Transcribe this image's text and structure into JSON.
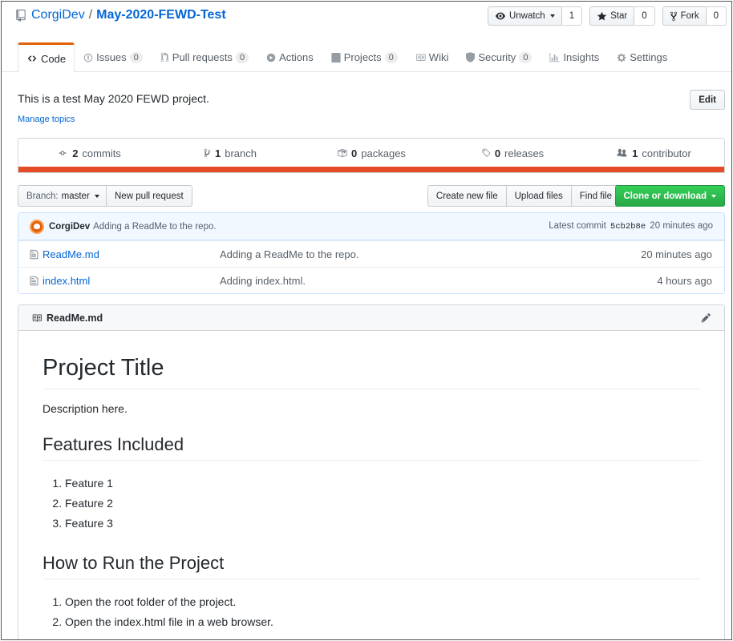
{
  "repo": {
    "owner": "CorgiDev",
    "separator": "/",
    "name": "May-2020-FEWD-Test"
  },
  "actions": {
    "watch": {
      "label": "Unwatch",
      "count": "1"
    },
    "star": {
      "label": "Star",
      "count": "0"
    },
    "fork": {
      "label": "Fork",
      "count": "0"
    }
  },
  "tabs": [
    {
      "label": "Code",
      "icon": "code-icon",
      "counter": ""
    },
    {
      "label": "Issues",
      "icon": "issue-icon",
      "counter": "0"
    },
    {
      "label": "Pull requests",
      "icon": "pull-request-icon",
      "counter": "0"
    },
    {
      "label": "Actions",
      "icon": "play-icon",
      "counter": ""
    },
    {
      "label": "Projects",
      "icon": "project-icon",
      "counter": "0"
    },
    {
      "label": "Wiki",
      "icon": "book-icon",
      "counter": ""
    },
    {
      "label": "Security",
      "icon": "shield-icon",
      "counter": "0"
    },
    {
      "label": "Insights",
      "icon": "graph-icon",
      "counter": ""
    },
    {
      "label": "Settings",
      "icon": "gear-icon",
      "counter": ""
    }
  ],
  "description": "This is a test May 2020 FEWD project.",
  "manage_topics": "Manage topics",
  "edit_label": "Edit",
  "summary": {
    "commits": {
      "num": "2",
      "label": "commits"
    },
    "branch": {
      "num": "1",
      "label": "branch"
    },
    "packages": {
      "num": "0",
      "label": "packages"
    },
    "releases": {
      "num": "0",
      "label": "releases"
    },
    "contributor": {
      "num": "1",
      "label": "contributor"
    }
  },
  "language_color": "#e34c26",
  "branch": {
    "prefix": "Branch:",
    "name": "master"
  },
  "new_pr": "New pull request",
  "file_buttons": [
    "Create new file",
    "Upload files",
    "Find file"
  ],
  "clone_label": "Clone or download",
  "latest_commit": {
    "author": "CorgiDev",
    "message": "Adding a ReadMe to the repo.",
    "prefix": "Latest commit",
    "sha": "5cb2b8e",
    "age": "20 minutes ago"
  },
  "files": [
    {
      "name": "ReadMe.md",
      "message": "Adding a ReadMe to the repo.",
      "age": "20 minutes ago"
    },
    {
      "name": "index.html",
      "message": "Adding index.html.",
      "age": "4 hours ago"
    }
  ],
  "readme": {
    "filename": "ReadMe.md",
    "title": "Project Title",
    "description": "Description here.",
    "features_heading": "Features Included",
    "features": [
      "Feature 1",
      "Feature 2",
      "Feature 3"
    ],
    "run_heading": "How to Run the Project",
    "steps": [
      "Open the root folder of the project.",
      "Open the index.html file in a web browser."
    ]
  }
}
